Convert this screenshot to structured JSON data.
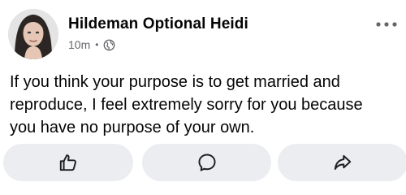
{
  "post": {
    "author_name": "Hildeman Optional Heidi",
    "timestamp": "10m",
    "separator": "•",
    "audience_icon": "globe-icon",
    "more_icon": "more-horizontal-icon",
    "text_lines": [
      "If you think your purpose is to get married and",
      "reproduce, I feel extremely sorry for you because",
      "you have no purpose of your own."
    ]
  },
  "actions": {
    "like_icon": "thumbs-up-icon",
    "comment_icon": "comment-bubble-icon",
    "share_icon": "share-arrow-icon"
  },
  "colors": {
    "text_primary": "#050505",
    "text_secondary": "#65676b",
    "action_bg": "#ebedf0",
    "icon": "#1c1e21"
  }
}
